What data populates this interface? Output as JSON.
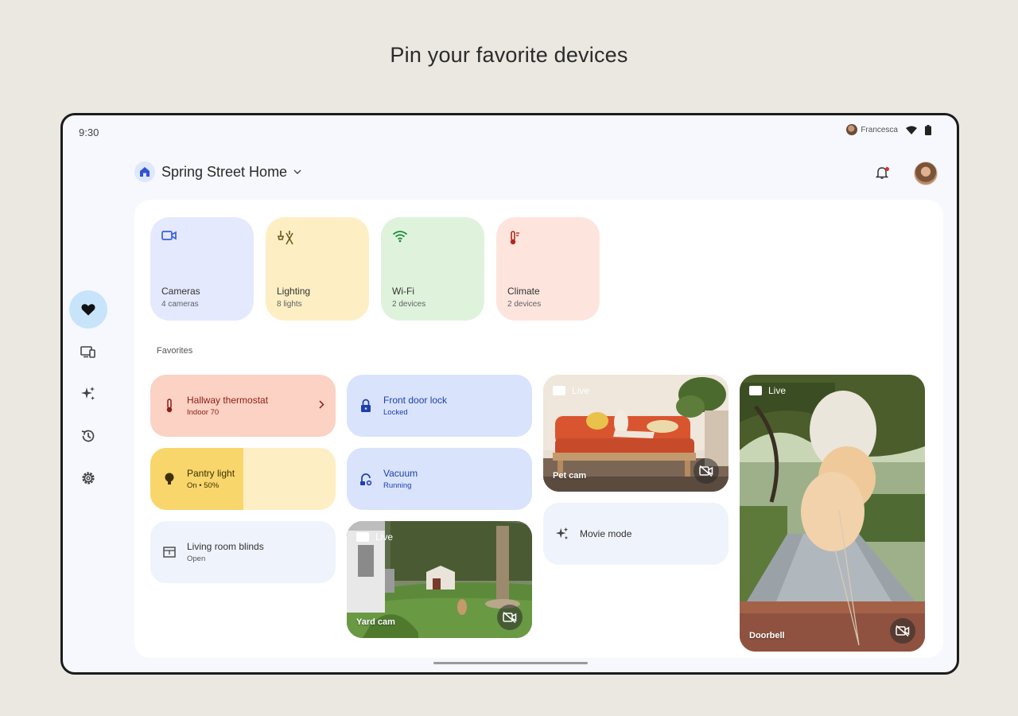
{
  "headline": "Pin your favorite devices",
  "status_bar": {
    "time": "9:30",
    "user": "Francesca",
    "icons": [
      "wifi-icon",
      "battery-icon"
    ]
  },
  "header": {
    "home_name": "Spring Street Home",
    "icons": [
      "home-icon",
      "chevron-down-icon",
      "bell-icon",
      "avatar"
    ]
  },
  "rail": [
    {
      "name": "favorites-icon",
      "active": true
    },
    {
      "name": "devices-icon",
      "active": false
    },
    {
      "name": "automations-icon",
      "active": false
    },
    {
      "name": "history-icon",
      "active": false
    },
    {
      "name": "settings-icon",
      "active": false
    }
  ],
  "categories": [
    {
      "title": "Cameras",
      "subtitle": "4 cameras",
      "icon": "camera-icon",
      "color": "#e5e9fd"
    },
    {
      "title": "Lighting",
      "subtitle": "8 lights",
      "icon": "lighting-icon",
      "color": "#fdefc3"
    },
    {
      "title": "Wi-Fi",
      "subtitle": "2 devices",
      "icon": "wifi-icon",
      "color": "#dff3dc"
    },
    {
      "title": "Climate",
      "subtitle": "2 devices",
      "icon": "thermometer-icon",
      "color": "#fde5dd"
    }
  ],
  "favorites_label": "Favorites",
  "favorites": {
    "thermostat": {
      "title": "Hallway thermostat",
      "subtitle": "Indoor 70",
      "color": "#fbd2c3"
    },
    "pantry": {
      "title": "Pantry light",
      "subtitle": "On • 50%",
      "brightness": 0.5,
      "color_on": "#f8d66b",
      "color_off": "#fdeec4"
    },
    "blinds": {
      "title": "Living room blinds",
      "subtitle": "Open",
      "color": "#eff3fb"
    },
    "lock": {
      "title": "Front door lock",
      "subtitle": "Locked",
      "color": "#d9e3fc"
    },
    "vacuum": {
      "title": "Vacuum",
      "subtitle": "Running",
      "color": "#d9e3fc"
    },
    "movie": {
      "title": "Movie mode",
      "color": "#eff3fb"
    },
    "pet_cam": {
      "live": "Live",
      "name": "Pet cam"
    },
    "yard_cam": {
      "live": "Live",
      "name": "Yard cam"
    },
    "doorbell": {
      "live": "Live",
      "name": "Doorbell"
    }
  }
}
